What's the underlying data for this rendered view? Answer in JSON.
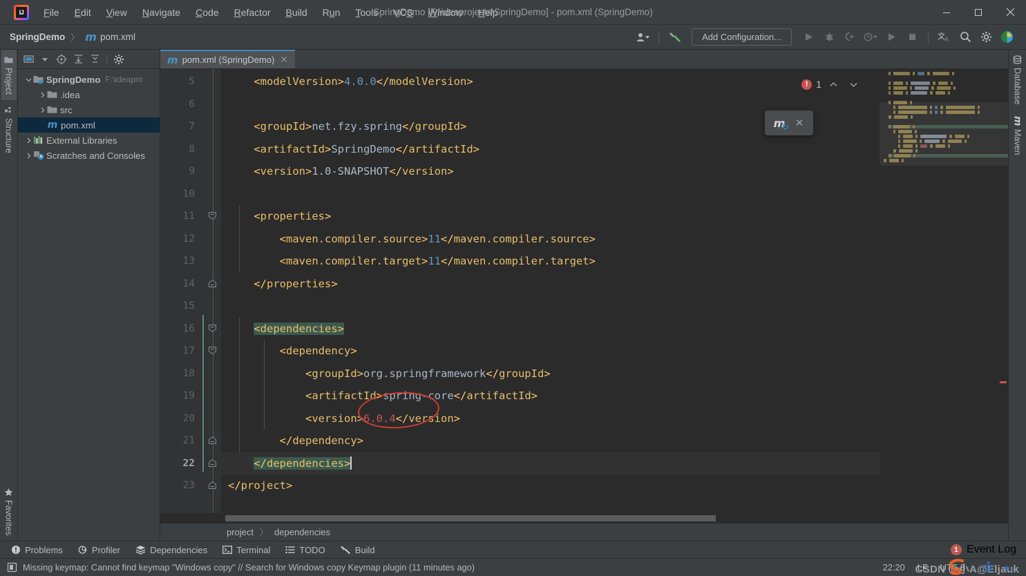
{
  "window": {
    "title": "SpringDemo [F:\\ideaprojests\\SpringDemo] - pom.xml (SpringDemo)",
    "minimize_glyph": "—",
    "maximize_glyph": "☐",
    "close_glyph": "✕"
  },
  "menu": [
    {
      "label": "File",
      "mnemonic": "F"
    },
    {
      "label": "Edit",
      "mnemonic": "E"
    },
    {
      "label": "View",
      "mnemonic": "V"
    },
    {
      "label": "Navigate",
      "mnemonic": "N"
    },
    {
      "label": "Code",
      "mnemonic": "C"
    },
    {
      "label": "Refactor",
      "mnemonic": "R"
    },
    {
      "label": "Build",
      "mnemonic": "B"
    },
    {
      "label": "Run",
      "mnemonic": "u"
    },
    {
      "label": "Tools",
      "mnemonic": "T"
    },
    {
      "label": "VCS",
      "mnemonic": "S"
    },
    {
      "label": "Window",
      "mnemonic": "W"
    },
    {
      "label": "Help",
      "mnemonic": "H"
    }
  ],
  "navbar": {
    "crumbs": [
      "SpringDemo",
      "pom.xml"
    ],
    "separator": "〉",
    "maven_glyph": "m",
    "add_configuration": "Add Configuration...",
    "icons": [
      "user-settings-icon",
      "hammer-build-icon",
      "run-icon",
      "debug-icon",
      "run-coverage-icon",
      "profile-icon",
      "run-anything-icon",
      "stop-icon",
      "translate-icon",
      "search-everywhere-icon",
      "settings-gear-icon",
      "ide-feature-icon"
    ]
  },
  "left_rail": {
    "top": [
      {
        "label": "Project",
        "icon": "project-folder-icon",
        "active": true
      },
      {
        "label": "Structure",
        "icon": "structure-icon",
        "active": false
      }
    ],
    "bottom": [
      {
        "label": "Favorites",
        "icon": "favorites-star-icon",
        "active": false
      }
    ]
  },
  "right_rail": {
    "items": [
      {
        "label": "Database",
        "icon": "database-icon"
      },
      {
        "label": "Maven",
        "icon": "maven-m-icon"
      }
    ]
  },
  "project_panel": {
    "toolbar_icons": [
      "select-opened-file-icon",
      "expand-dropdown-icon",
      "locate-icon",
      "expand-all-icon",
      "collapse-all-icon",
      "settings-gear-icon"
    ],
    "tree": [
      {
        "label": "SpringDemo",
        "path": "F:\\ideapro",
        "depth": 0,
        "arrow": "down",
        "icon": "module-folder-icon",
        "bold": true,
        "selected": false
      },
      {
        "label": ".idea",
        "path": "",
        "depth": 1,
        "arrow": "right",
        "icon": "folder-icon",
        "bold": false,
        "selected": false
      },
      {
        "label": "src",
        "path": "",
        "depth": 1,
        "arrow": "right",
        "icon": "folder-icon",
        "bold": false,
        "selected": false
      },
      {
        "label": "pom.xml",
        "path": "",
        "depth": 1,
        "arrow": "none",
        "icon": "maven-m-icon",
        "bold": false,
        "selected": true
      },
      {
        "label": "External Libraries",
        "path": "",
        "depth": 0,
        "arrow": "right",
        "icon": "libraries-icon",
        "bold": false,
        "selected": false
      },
      {
        "label": "Scratches and Consoles",
        "path": "",
        "depth": 0,
        "arrow": "right",
        "icon": "scratches-icon",
        "bold": false,
        "selected": false
      }
    ]
  },
  "editor": {
    "tab": {
      "title": "pom.xml (SpringDemo)",
      "icon": "maven-m-icon",
      "close_glyph": "✕"
    },
    "first_visible_line": 5,
    "caret_line": 22,
    "inspection": {
      "error_count": "1",
      "badge_glyph": "!",
      "up_glyph": "⌃",
      "down_glyph": "⌄"
    },
    "maven_popup": {
      "icon": "maven-reload-icon",
      "refresh_glyph": "↻",
      "close_glyph": "✕"
    },
    "lines": [
      {
        "num": 5,
        "indent": 1,
        "fold": "none",
        "cur": false,
        "hl": false,
        "tokens": [
          {
            "t": "br",
            "v": "<"
          },
          {
            "t": "tn",
            "v": "modelVersion"
          },
          {
            "t": "br",
            "v": ">"
          },
          {
            "t": "num",
            "v": "4.0.0"
          },
          {
            "t": "br",
            "v": "</"
          },
          {
            "t": "tn",
            "v": "modelVersion"
          },
          {
            "t": "br",
            "v": ">"
          }
        ]
      },
      {
        "num": 6,
        "indent": 0,
        "fold": "none",
        "cur": false,
        "hl": false,
        "tokens": []
      },
      {
        "num": 7,
        "indent": 1,
        "fold": "none",
        "cur": false,
        "hl": false,
        "tokens": [
          {
            "t": "br",
            "v": "<"
          },
          {
            "t": "tn",
            "v": "groupId"
          },
          {
            "t": "br",
            "v": ">"
          },
          {
            "t": "txt",
            "v": "net.fzy.spring"
          },
          {
            "t": "br",
            "v": "</"
          },
          {
            "t": "tn",
            "v": "groupId"
          },
          {
            "t": "br",
            "v": ">"
          }
        ]
      },
      {
        "num": 8,
        "indent": 1,
        "fold": "none",
        "cur": false,
        "hl": false,
        "tokens": [
          {
            "t": "br",
            "v": "<"
          },
          {
            "t": "tn",
            "v": "artifactId"
          },
          {
            "t": "br",
            "v": ">"
          },
          {
            "t": "txt",
            "v": "SpringDemo"
          },
          {
            "t": "br",
            "v": "</"
          },
          {
            "t": "tn",
            "v": "artifactId"
          },
          {
            "t": "br",
            "v": ">"
          }
        ]
      },
      {
        "num": 9,
        "indent": 1,
        "fold": "none",
        "cur": false,
        "hl": false,
        "tokens": [
          {
            "t": "br",
            "v": "<"
          },
          {
            "t": "tn",
            "v": "version"
          },
          {
            "t": "br",
            "v": ">"
          },
          {
            "t": "txt",
            "v": "1.0-SNAPSHOT"
          },
          {
            "t": "br",
            "v": "</"
          },
          {
            "t": "tn",
            "v": "version"
          },
          {
            "t": "br",
            "v": ">"
          }
        ]
      },
      {
        "num": 10,
        "indent": 0,
        "fold": "none",
        "cur": false,
        "hl": false,
        "tokens": []
      },
      {
        "num": 11,
        "indent": 1,
        "fold": "open",
        "cur": false,
        "hl": false,
        "tokens": [
          {
            "t": "br",
            "v": "<"
          },
          {
            "t": "tn",
            "v": "properties"
          },
          {
            "t": "br",
            "v": ">"
          }
        ]
      },
      {
        "num": 12,
        "indent": 2,
        "fold": "none",
        "cur": false,
        "hl": false,
        "tokens": [
          {
            "t": "br",
            "v": "<"
          },
          {
            "t": "tn",
            "v": "maven.compiler.source"
          },
          {
            "t": "br",
            "v": ">"
          },
          {
            "t": "num",
            "v": "11"
          },
          {
            "t": "br",
            "v": "</"
          },
          {
            "t": "tn",
            "v": "maven.compiler.source"
          },
          {
            "t": "br",
            "v": ">"
          }
        ]
      },
      {
        "num": 13,
        "indent": 2,
        "fold": "none",
        "cur": false,
        "hl": false,
        "tokens": [
          {
            "t": "br",
            "v": "<"
          },
          {
            "t": "tn",
            "v": "maven.compiler.target"
          },
          {
            "t": "br",
            "v": ">"
          },
          {
            "t": "num",
            "v": "11"
          },
          {
            "t": "br",
            "v": "</"
          },
          {
            "t": "tn",
            "v": "maven.compiler.target"
          },
          {
            "t": "br",
            "v": ">"
          }
        ]
      },
      {
        "num": 14,
        "indent": 1,
        "fold": "close",
        "cur": false,
        "hl": false,
        "tokens": [
          {
            "t": "br",
            "v": "</"
          },
          {
            "t": "tn",
            "v": "properties"
          },
          {
            "t": "br",
            "v": ">"
          }
        ]
      },
      {
        "num": 15,
        "indent": 0,
        "fold": "none",
        "cur": false,
        "hl": false,
        "tokens": []
      },
      {
        "num": 16,
        "indent": 1,
        "fold": "open",
        "cur": false,
        "hl": true,
        "tokens": [
          {
            "t": "br",
            "v": "<"
          },
          {
            "t": "tn",
            "v": "dependencies"
          },
          {
            "t": "br",
            "v": ">"
          }
        ]
      },
      {
        "num": 17,
        "indent": 2,
        "fold": "open",
        "cur": false,
        "hl": false,
        "tokens": [
          {
            "t": "br",
            "v": "<"
          },
          {
            "t": "tn",
            "v": "dependency"
          },
          {
            "t": "br",
            "v": ">"
          }
        ]
      },
      {
        "num": 18,
        "indent": 3,
        "fold": "none",
        "cur": false,
        "hl": false,
        "tokens": [
          {
            "t": "br",
            "v": "<"
          },
          {
            "t": "tn",
            "v": "groupId"
          },
          {
            "t": "br",
            "v": ">"
          },
          {
            "t": "txt",
            "v": "org.springframework"
          },
          {
            "t": "br",
            "v": "</"
          },
          {
            "t": "tn",
            "v": "groupId"
          },
          {
            "t": "br",
            "v": ">"
          }
        ]
      },
      {
        "num": 19,
        "indent": 3,
        "fold": "none",
        "cur": false,
        "hl": false,
        "tokens": [
          {
            "t": "br",
            "v": "<"
          },
          {
            "t": "tn",
            "v": "artifactId"
          },
          {
            "t": "br",
            "v": ">"
          },
          {
            "t": "txt",
            "v": "spring-core"
          },
          {
            "t": "br",
            "v": "</"
          },
          {
            "t": "tn",
            "v": "artifactId"
          },
          {
            "t": "br",
            "v": ">"
          }
        ]
      },
      {
        "num": 20,
        "indent": 3,
        "fold": "none",
        "cur": false,
        "hl": false,
        "tokens": [
          {
            "t": "br",
            "v": "<"
          },
          {
            "t": "tn",
            "v": "version"
          },
          {
            "t": "br",
            "v": ">"
          },
          {
            "t": "errtxt",
            "v": "6.0.4"
          },
          {
            "t": "br",
            "v": "</"
          },
          {
            "t": "tn",
            "v": "version"
          },
          {
            "t": "br",
            "v": ">"
          }
        ]
      },
      {
        "num": 21,
        "indent": 2,
        "fold": "close",
        "cur": false,
        "hl": false,
        "tokens": [
          {
            "t": "br",
            "v": "</"
          },
          {
            "t": "tn",
            "v": "dependency"
          },
          {
            "t": "br",
            "v": ">"
          }
        ]
      },
      {
        "num": 22,
        "indent": 1,
        "fold": "close",
        "cur": true,
        "hl": true,
        "tokens": [
          {
            "t": "br",
            "v": "</"
          },
          {
            "t": "tn",
            "v": "dependencies"
          },
          {
            "t": "br",
            "v": ">"
          }
        ]
      },
      {
        "num": 23,
        "indent": 0,
        "fold": "close",
        "cur": false,
        "hl": false,
        "tokens": [
          {
            "t": "br",
            "v": "</"
          },
          {
            "t": "tn",
            "v": "project"
          },
          {
            "t": "br",
            "v": ">"
          }
        ]
      }
    ],
    "annotation": {
      "shape": "ellipse",
      "color": "#d23c32",
      "target_text": "6.0.4"
    },
    "breadcrumbs": [
      "project",
      "dependencies"
    ],
    "breadcrumb_separator": "〉"
  },
  "toolwindow_bar": {
    "buttons": [
      {
        "label": "Problems",
        "icon": "problems-icon"
      },
      {
        "label": "Profiler",
        "icon": "profiler-icon"
      },
      {
        "label": "Dependencies",
        "icon": "dependencies-layers-icon"
      },
      {
        "label": "Terminal",
        "icon": "terminal-icon"
      },
      {
        "label": "TODO",
        "icon": "todo-list-icon"
      },
      {
        "label": "Build",
        "icon": "build-hammer-icon"
      }
    ],
    "event_log": {
      "label": "Event Log",
      "count": "1"
    }
  },
  "statusbar": {
    "message": "Missing keymap: Cannot find keymap \"Windows copy\" // Search for Windows copy Keymap plugin (11 minutes ago)",
    "message_icon": "notification-icon",
    "time": "22:20",
    "line_separator": "LF",
    "encoding": "UTF-8",
    "watermark": "CSDN @小A@Eljauk"
  },
  "colors": {
    "bg_chrome": "#3c3f41",
    "bg_editor": "#2b2b2b",
    "bg_gutter": "#313335",
    "accent_blue": "#4a88c7",
    "tag_orange": "#e8bf6a",
    "bracket_yellow": "#ffc66d",
    "text_default": "#a9b7c6",
    "number_blue": "#6897bb",
    "error_red": "#c75450",
    "highlight_teal": "#3c5a4d",
    "selection_blue": "#0d293e"
  }
}
